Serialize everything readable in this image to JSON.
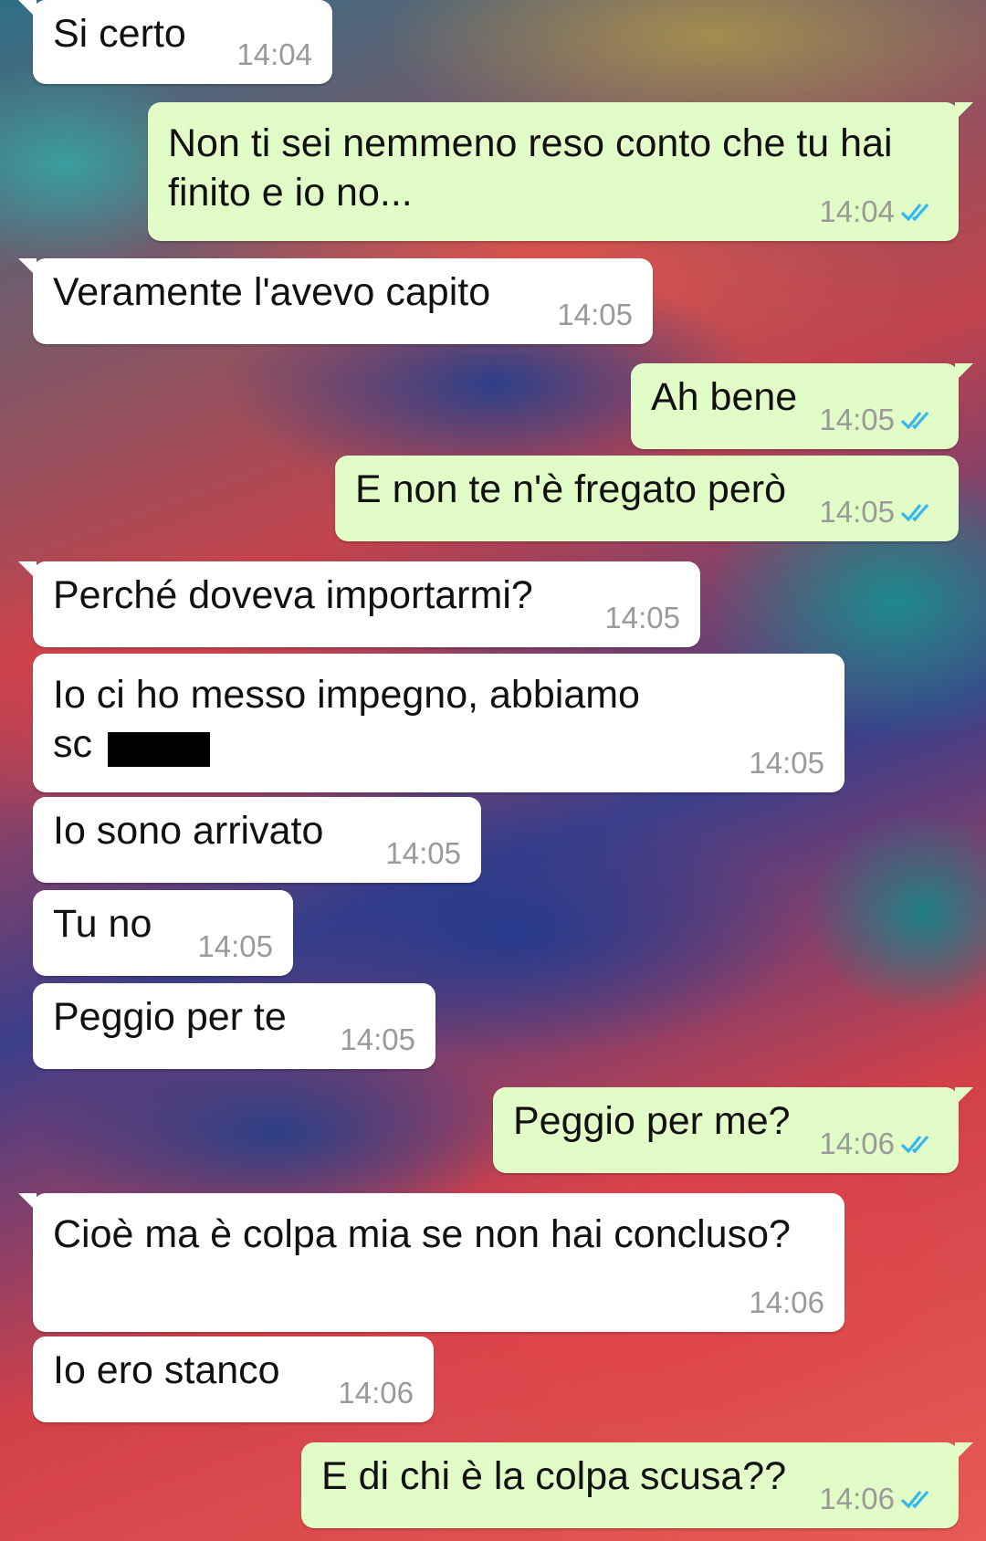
{
  "messages": [
    {
      "direction": "incoming",
      "text": "Si certo",
      "time": "14:04"
    },
    {
      "direction": "outgoing",
      "text_lines": [
        "Non ti sei nemmeno reso conto che tu hai",
        "finito e io no..."
      ],
      "time": "14:04",
      "status": "read"
    },
    {
      "direction": "incoming",
      "text": "Veramente l'avevo capito",
      "time": "14:05"
    },
    {
      "direction": "outgoing",
      "text": "Ah bene",
      "time": "14:05",
      "status": "read"
    },
    {
      "direction": "outgoing",
      "text": "E non te n'è fregato però",
      "time": "14:05",
      "status": "read"
    },
    {
      "direction": "incoming",
      "text": "Perché doveva importarmi?",
      "time": "14:05"
    },
    {
      "direction": "incoming",
      "text_lines": [
        "Io ci ho messo impegno, abbiamo",
        "sc"
      ],
      "time": "14:05",
      "redacted": true
    },
    {
      "direction": "incoming",
      "text": "Io sono arrivato",
      "time": "14:05"
    },
    {
      "direction": "incoming",
      "text": "Tu no",
      "time": "14:05"
    },
    {
      "direction": "incoming",
      "text": "Peggio per te",
      "time": "14:05"
    },
    {
      "direction": "outgoing",
      "text": "Peggio per me?",
      "time": "14:06",
      "status": "read"
    },
    {
      "direction": "incoming",
      "text": "Cioè ma è colpa mia se non hai concluso?",
      "time": "14:06"
    },
    {
      "direction": "incoming",
      "text": "Io ero stanco",
      "time": "14:06"
    },
    {
      "direction": "outgoing",
      "text": "E di chi è la colpa scusa??",
      "time": "14:06",
      "status": "read"
    }
  ],
  "colors": {
    "incoming_bubble": "#ffffff",
    "outgoing_bubble": "#e2fcc8",
    "timestamp": "#9a9a9a",
    "read_ticks": "#34b7f1"
  },
  "icons": {
    "read_receipt": "double-check-icon"
  }
}
